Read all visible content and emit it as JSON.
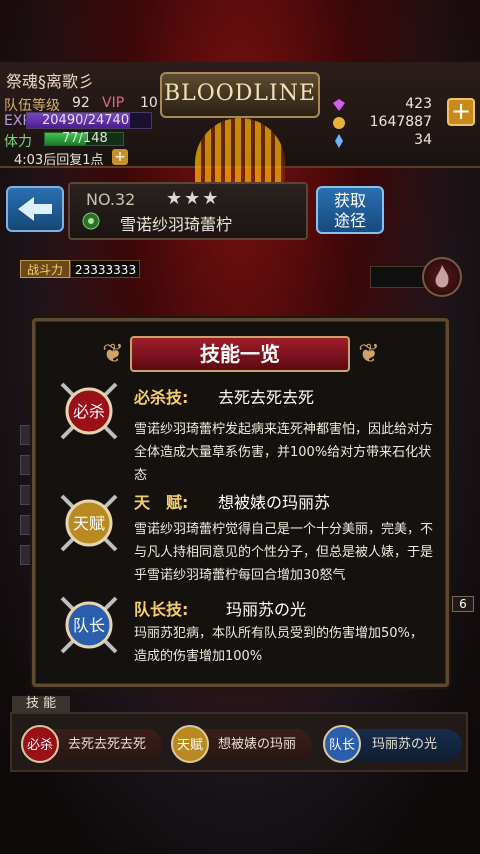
{
  "player": {
    "name": "祭魂§离歌彡",
    "level_label": "队伍等级",
    "level": "92",
    "vip_label": "VIP",
    "vip": "10",
    "exp_label": "EXP",
    "exp_text": "20490/24740",
    "exp_fraction": 0.828,
    "stamina_label": "体力",
    "stamina_text": "77/148",
    "stamina_fraction": 0.52,
    "recover_text": "4:03后回复1点"
  },
  "logo_text": "BLOODLINE",
  "resources": {
    "gems": "423",
    "gold": "1647887",
    "crystal": "34"
  },
  "character": {
    "number": "NO.32",
    "stars": "★★★",
    "name": "雪诺纱羽琦蕾柠",
    "power_label": "战斗力",
    "power_value": "23333333"
  },
  "buttons": {
    "get_line1": "获取",
    "get_line2": "途径",
    "back": "←",
    "plus": "+",
    "plus_big": "+",
    "small_six": "6"
  },
  "modal": {
    "title": "技能一览",
    "skills": [
      {
        "type": "必杀技:",
        "badge": "必杀",
        "name": "去死去死去死",
        "desc": "雪诺纱羽琦蕾柠发起病来连死神都害怕，因此给对方全体造成大量草系伤害，并100%给对方带来石化状态"
      },
      {
        "type": "天　赋:",
        "badge": "天赋",
        "name": "想被婊の玛丽苏",
        "desc": "雪诺纱羽琦蕾柠觉得自己是一个十分美丽，完美，不与凡人持相同意见的个性分子，但总是被人婊，于是乎雪诺纱羽琦蕾柠每回合增加30怒气"
      },
      {
        "type": "队长技:",
        "badge": "队长",
        "name": "玛丽苏の光",
        "desc": "玛丽苏犯病，本队所有队员受到的伤害增加50%，造成的伤害增加100%"
      }
    ]
  },
  "bottom": {
    "section_label": "技 能",
    "chips": [
      {
        "badge": "必杀",
        "label": "去死去死去死"
      },
      {
        "badge": "天赋",
        "label": "想被婊の玛丽"
      },
      {
        "badge": "队长",
        "label": "玛丽苏の光"
      }
    ]
  },
  "colors": {
    "accent_red": "#a01d2a",
    "gold": "#f5d06a",
    "blue_btn": "#2a6fb0"
  }
}
